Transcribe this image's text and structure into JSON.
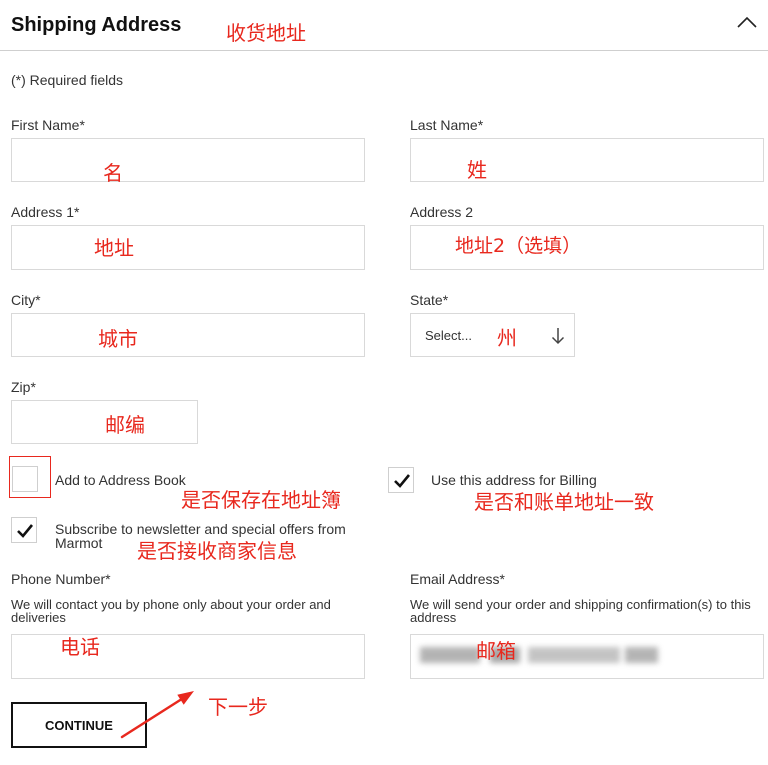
{
  "colors": {
    "title": "#111111",
    "text": "#333333",
    "border": "#d9d9d9",
    "divider": "#cfcfcf",
    "button_border": "#111111",
    "anno": "#e8281e"
  },
  "header": {
    "title": "Shipping Address",
    "collapse_icon": "chevron-up-icon"
  },
  "required_note": "(*) Required fields",
  "form": {
    "first_name": {
      "label": "First Name*"
    },
    "last_name": {
      "label": "Last Name*"
    },
    "address1": {
      "label": "Address 1*"
    },
    "address2": {
      "label": "Address 2"
    },
    "city": {
      "label": "City*"
    },
    "state": {
      "label": "State*",
      "selected": "Select...",
      "icon": "arrow-down-icon"
    },
    "zip": {
      "label": "Zip*"
    },
    "add_to_address_book": {
      "label": "Add to Address Book",
      "checked": false
    },
    "use_for_billing": {
      "label": "Use this address for Billing",
      "checked": true
    },
    "newsletter": {
      "label": "Subscribe to newsletter and special offers from Marmot",
      "checked": true
    },
    "phone": {
      "label": "Phone Number*",
      "help": "We will contact you by phone only about your order and deliveries"
    },
    "email": {
      "label": "Email Address*",
      "help": "We will send your order and shipping confirmation(s) to this address",
      "value_blurred": true
    }
  },
  "continue_button": {
    "label": "CONTINUE"
  },
  "annotations": {
    "header": "收货地址",
    "first_name": "名",
    "last_name": "姓",
    "address1": "地址",
    "address2": "地址2（选填）",
    "city": "城市",
    "state": "州",
    "zip": "邮编",
    "add_to_address_book": "是否保存在地址簿",
    "use_for_billing": "是否和账单地址一致",
    "newsletter": "是否接收商家信息",
    "phone": "电话",
    "email": "邮箱",
    "continue": "下一步"
  }
}
